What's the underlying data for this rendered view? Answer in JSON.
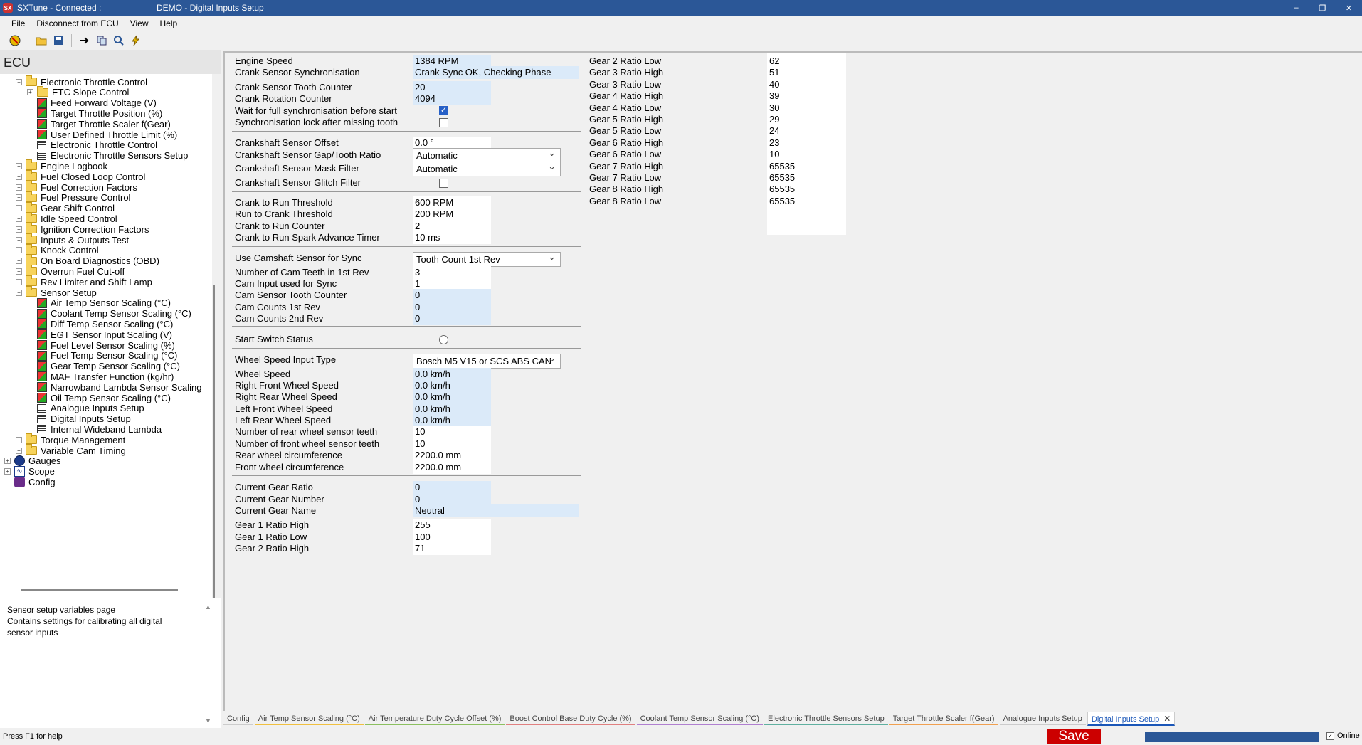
{
  "window": {
    "app_title": "SXTune - Connected :",
    "doc_title": "DEMO - Digital Inputs Setup",
    "minimize": "–",
    "restore": "❐",
    "close": "✕"
  },
  "menu": [
    "File",
    "Disconnect from ECU",
    "View",
    "Help"
  ],
  "tree": {
    "header": "ECU",
    "items": [
      {
        "label": "Electronic Throttle Control",
        "indent": 1,
        "icon": "folder",
        "exp": "−"
      },
      {
        "label": "ETC Slope Control",
        "indent": 2,
        "icon": "folder",
        "exp": "+"
      },
      {
        "label": "Feed Forward Voltage (V)",
        "indent": 2,
        "icon": "cube"
      },
      {
        "label": "Target Throttle Position (%)",
        "indent": 2,
        "icon": "cube"
      },
      {
        "label": "Target Throttle Scaler f(Gear)",
        "indent": 2,
        "icon": "cube"
      },
      {
        "label": "User Defined Throttle Limit (%)",
        "indent": 2,
        "icon": "cube"
      },
      {
        "label": "Electronic Throttle Control",
        "indent": 2,
        "icon": "grid"
      },
      {
        "label": "Electronic Throttle Sensors Setup",
        "indent": 2,
        "icon": "grid"
      },
      {
        "label": "Engine Logbook",
        "indent": 1,
        "icon": "folder",
        "exp": "+"
      },
      {
        "label": "Fuel Closed Loop Control",
        "indent": 1,
        "icon": "folder",
        "exp": "+"
      },
      {
        "label": "Fuel Correction Factors",
        "indent": 1,
        "icon": "folder",
        "exp": "+"
      },
      {
        "label": "Fuel Pressure Control",
        "indent": 1,
        "icon": "folder",
        "exp": "+"
      },
      {
        "label": "Gear Shift Control",
        "indent": 1,
        "icon": "folder",
        "exp": "+"
      },
      {
        "label": "Idle Speed Control",
        "indent": 1,
        "icon": "folder",
        "exp": "+"
      },
      {
        "label": "Ignition Correction Factors",
        "indent": 1,
        "icon": "folder",
        "exp": "+"
      },
      {
        "label": "Inputs & Outputs Test",
        "indent": 1,
        "icon": "folder",
        "exp": "+"
      },
      {
        "label": "Knock Control",
        "indent": 1,
        "icon": "folder",
        "exp": "+"
      },
      {
        "label": "On Board Diagnostics (OBD)",
        "indent": 1,
        "icon": "folder",
        "exp": "+"
      },
      {
        "label": "Overrun Fuel Cut-off",
        "indent": 1,
        "icon": "folder",
        "exp": "+"
      },
      {
        "label": "Rev Limiter and Shift Lamp",
        "indent": 1,
        "icon": "folder",
        "exp": "+"
      },
      {
        "label": "Sensor Setup",
        "indent": 1,
        "icon": "folder",
        "exp": "−"
      },
      {
        "label": "Air Temp Sensor Scaling (°C)",
        "indent": 2,
        "icon": "cube"
      },
      {
        "label": "Coolant Temp Sensor Scaling (°C)",
        "indent": 2,
        "icon": "cube"
      },
      {
        "label": "Diff Temp Sensor Scaling (°C)",
        "indent": 2,
        "icon": "cube"
      },
      {
        "label": "EGT Sensor Input Scaling (V)",
        "indent": 2,
        "icon": "cube"
      },
      {
        "label": "Fuel Level Sensor Scaling (%)",
        "indent": 2,
        "icon": "cube"
      },
      {
        "label": "Fuel Temp Sensor Scaling (°C)",
        "indent": 2,
        "icon": "cube"
      },
      {
        "label": "Gear Temp Sensor Scaling (°C)",
        "indent": 2,
        "icon": "cube"
      },
      {
        "label": "MAF Transfer Function (kg/hr)",
        "indent": 2,
        "icon": "cube"
      },
      {
        "label": "Narrowband Lambda Sensor Scaling",
        "indent": 2,
        "icon": "cube"
      },
      {
        "label": "Oil Temp Sensor Scaling (°C)",
        "indent": 2,
        "icon": "cube"
      },
      {
        "label": "Analogue Inputs Setup",
        "indent": 2,
        "icon": "grid"
      },
      {
        "label": "Digital Inputs Setup",
        "indent": 2,
        "icon": "grid"
      },
      {
        "label": "Internal Wideband Lambda",
        "indent": 2,
        "icon": "grid"
      },
      {
        "label": "Torque Management",
        "indent": 1,
        "icon": "folder",
        "exp": "+"
      },
      {
        "label": "Variable Cam Timing",
        "indent": 1,
        "icon": "folder",
        "exp": "+"
      },
      {
        "label": "Gauges",
        "indent": 0,
        "icon": "gauge",
        "exp": "+"
      },
      {
        "label": "Scope",
        "indent": 0,
        "icon": "scope",
        "exp": "+"
      },
      {
        "label": "Config",
        "indent": 0,
        "icon": "config"
      }
    ]
  },
  "description": {
    "line1": "Sensor setup variables page",
    "line2": "Contains settings for calibrating all digital",
    "line3": "sensor inputs"
  },
  "form": {
    "engine_speed": {
      "label": "Engine Speed",
      "value": "1384 RPM"
    },
    "crank_sync": {
      "label": "Crank Sensor Synchronisation",
      "value": "Crank Sync OK, Checking Phase"
    },
    "crank_tooth_counter": {
      "label": "Crank Sensor Tooth Counter",
      "value": "20"
    },
    "crank_rotation_counter": {
      "label": "Crank Rotation Counter",
      "value": "4094"
    },
    "wait_full_sync": {
      "label": "Wait for full synchronisation before start",
      "checked": "✓"
    },
    "sync_lock": {
      "label": "Synchronisation lock after missing tooth"
    },
    "crank_offset": {
      "label": "Crankshaft Sensor Offset",
      "value": "0.0 °"
    },
    "crank_gap_ratio": {
      "label": "Crankshaft Sensor Gap/Tooth Ratio",
      "value": "Automatic"
    },
    "crank_mask_filter": {
      "label": "Crankshaft Sensor Mask Filter",
      "value": "Automatic"
    },
    "crank_glitch_filter": {
      "label": "Crankshaft Sensor Glitch Filter"
    },
    "crank_to_run_threshold": {
      "label": "Crank to Run Threshold",
      "value": "600 RPM"
    },
    "run_to_crank_threshold": {
      "label": "Run to Crank Threshold",
      "value": "200 RPM"
    },
    "crank_to_run_counter": {
      "label": "Crank to Run Counter",
      "value": "2"
    },
    "crank_spark_timer": {
      "label": "Crank to Run Spark Advance Timer",
      "value": "10 ms"
    },
    "use_cam_sync": {
      "label": "Use Camshaft Sensor for Sync",
      "value": "Tooth Count 1st Rev"
    },
    "cam_teeth_1st": {
      "label": "Number of Cam Teeth in 1st Rev",
      "value": "3"
    },
    "cam_input_sync": {
      "label": "Cam Input used for Sync",
      "value": "1"
    },
    "cam_tooth_counter": {
      "label": "Cam Sensor Tooth Counter",
      "value": "0"
    },
    "cam_counts_1st": {
      "label": "Cam Counts 1st Rev",
      "value": "0"
    },
    "cam_counts_2nd": {
      "label": "Cam Counts 2nd Rev",
      "value": "0"
    },
    "start_switch": {
      "label": "Start Switch Status"
    },
    "wheel_speed_type": {
      "label": "Wheel Speed Input Type",
      "value": "Bosch M5 V15 or SCS ABS CAN"
    },
    "wheel_speed": {
      "label": "Wheel Speed",
      "value": "0.0 km/h"
    },
    "rf_wheel": {
      "label": "Right Front Wheel Speed",
      "value": "0.0 km/h"
    },
    "rr_wheel": {
      "label": "Right Rear Wheel Speed",
      "value": "0.0 km/h"
    },
    "lf_wheel": {
      "label": "Left Front Wheel Speed",
      "value": "0.0 km/h"
    },
    "lr_wheel": {
      "label": "Left Rear Wheel Speed",
      "value": "0.0 km/h"
    },
    "rear_teeth": {
      "label": "Number of rear wheel sensor teeth",
      "value": "10"
    },
    "front_teeth": {
      "label": "Number of front wheel sensor teeth",
      "value": "10"
    },
    "rear_circ": {
      "label": "Rear wheel circumference",
      "value": "2200.0 mm"
    },
    "front_circ": {
      "label": "Front wheel circumference",
      "value": "2200.0 mm"
    },
    "gear_ratio": {
      "label": "Current Gear Ratio",
      "value": "0"
    },
    "gear_number": {
      "label": "Current Gear Number",
      "value": "0"
    },
    "gear_name": {
      "label": "Current Gear Name",
      "value": "Neutral"
    },
    "g1_high": {
      "label": "Gear 1 Ratio High",
      "value": "255"
    },
    "g1_low": {
      "label": "Gear 1 Ratio Low",
      "value": "100"
    },
    "g2_high": {
      "label": "Gear 2 Ratio High",
      "value": "71"
    }
  },
  "gears": [
    {
      "label": "Gear 2 Ratio Low",
      "value": "62"
    },
    {
      "label": "Gear 3 Ratio High",
      "value": "51"
    },
    {
      "label": "Gear 3 Ratio Low",
      "value": "40"
    },
    {
      "label": "Gear 4 Ratio High",
      "value": "39"
    },
    {
      "label": "Gear 4 Ratio Low",
      "value": "30"
    },
    {
      "label": "Gear 5 Ratio High",
      "value": "29"
    },
    {
      "label": "Gear 5 Ratio Low",
      "value": "24"
    },
    {
      "label": "Gear 6 Ratio High",
      "value": "23"
    },
    {
      "label": "Gear 6 Ratio Low",
      "value": "10"
    },
    {
      "label": "Gear 7 Ratio High",
      "value": "65535"
    },
    {
      "label": "Gear 7 Ratio Low",
      "value": "65535"
    },
    {
      "label": "Gear 8 Ratio High",
      "value": "65535"
    },
    {
      "label": "Gear 8 Ratio Low",
      "value": "65535"
    }
  ],
  "tabs": [
    {
      "label": "Config",
      "color": "#cccccc"
    },
    {
      "label": "Air Temp Sensor Scaling (°C)",
      "color": "#f0c040"
    },
    {
      "label": "Air Temperature Duty Cycle Offset (%)",
      "color": "#8cc060"
    },
    {
      "label": "Boost Control Base Duty Cycle (%)",
      "color": "#e08080"
    },
    {
      "label": "Coolant Temp Sensor Scaling (°C)",
      "color": "#b080d0"
    },
    {
      "label": "Electronic Throttle Sensors Setup",
      "color": "#60b0a0"
    },
    {
      "label": "Target Throttle Scaler f(Gear)",
      "color": "#f0a050"
    },
    {
      "label": "Analogue Inputs Setup",
      "color": "#cccccc"
    },
    {
      "label": "Digital Inputs Setup",
      "color": "#1a56b8"
    }
  ],
  "status": {
    "help": "Press F1 for help",
    "save": "Save",
    "online": "Online",
    "online_check": "✓"
  }
}
